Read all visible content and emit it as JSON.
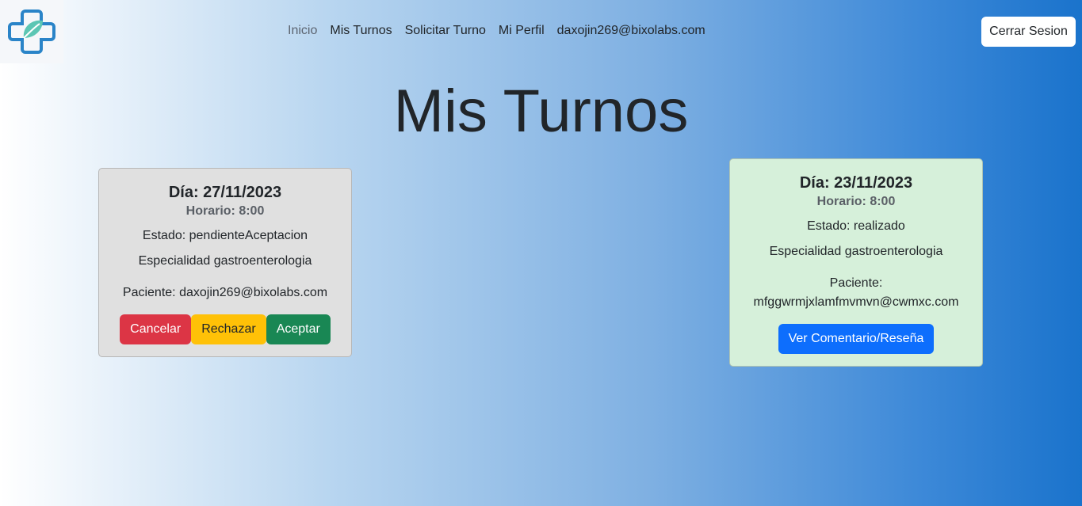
{
  "nav": {
    "logo_icon": "medical-cross-leaf-icon",
    "links": [
      "Inicio",
      "Mis Turnos",
      "Solicitar Turno",
      "Mi Perfil",
      "daxojin269@bixolabs.com"
    ],
    "logout_label": "Cerrar Sesion"
  },
  "page": {
    "title": "Mis Turnos"
  },
  "cards": [
    {
      "day": "Día: 27/11/2023",
      "time": "Horario: 8:00",
      "status": "Estado: pendienteAceptacion",
      "specialty": "Especialidad gastroenterologia",
      "patient": "Paciente: daxojin269@bixolabs.com",
      "buttons": [
        "Cancelar",
        "Rechazar",
        "Aceptar"
      ],
      "bg_color": "#e0e0e0"
    },
    {
      "day": "Día: 23/11/2023",
      "time": "Horario: 8:00",
      "status": "Estado: realizado",
      "specialty": "Especialidad gastroenterologia",
      "patient_label": "Paciente:",
      "patient_email": "mfggwrmjxlamfmvmvn@cwmxc.com",
      "review_button": "Ver Comentario/Reseña",
      "bg_color": "#d6f0da"
    }
  ],
  "colors": {
    "danger": "#dc3545",
    "warning": "#ffc107",
    "success": "#198754",
    "primary": "#0d6efd"
  }
}
